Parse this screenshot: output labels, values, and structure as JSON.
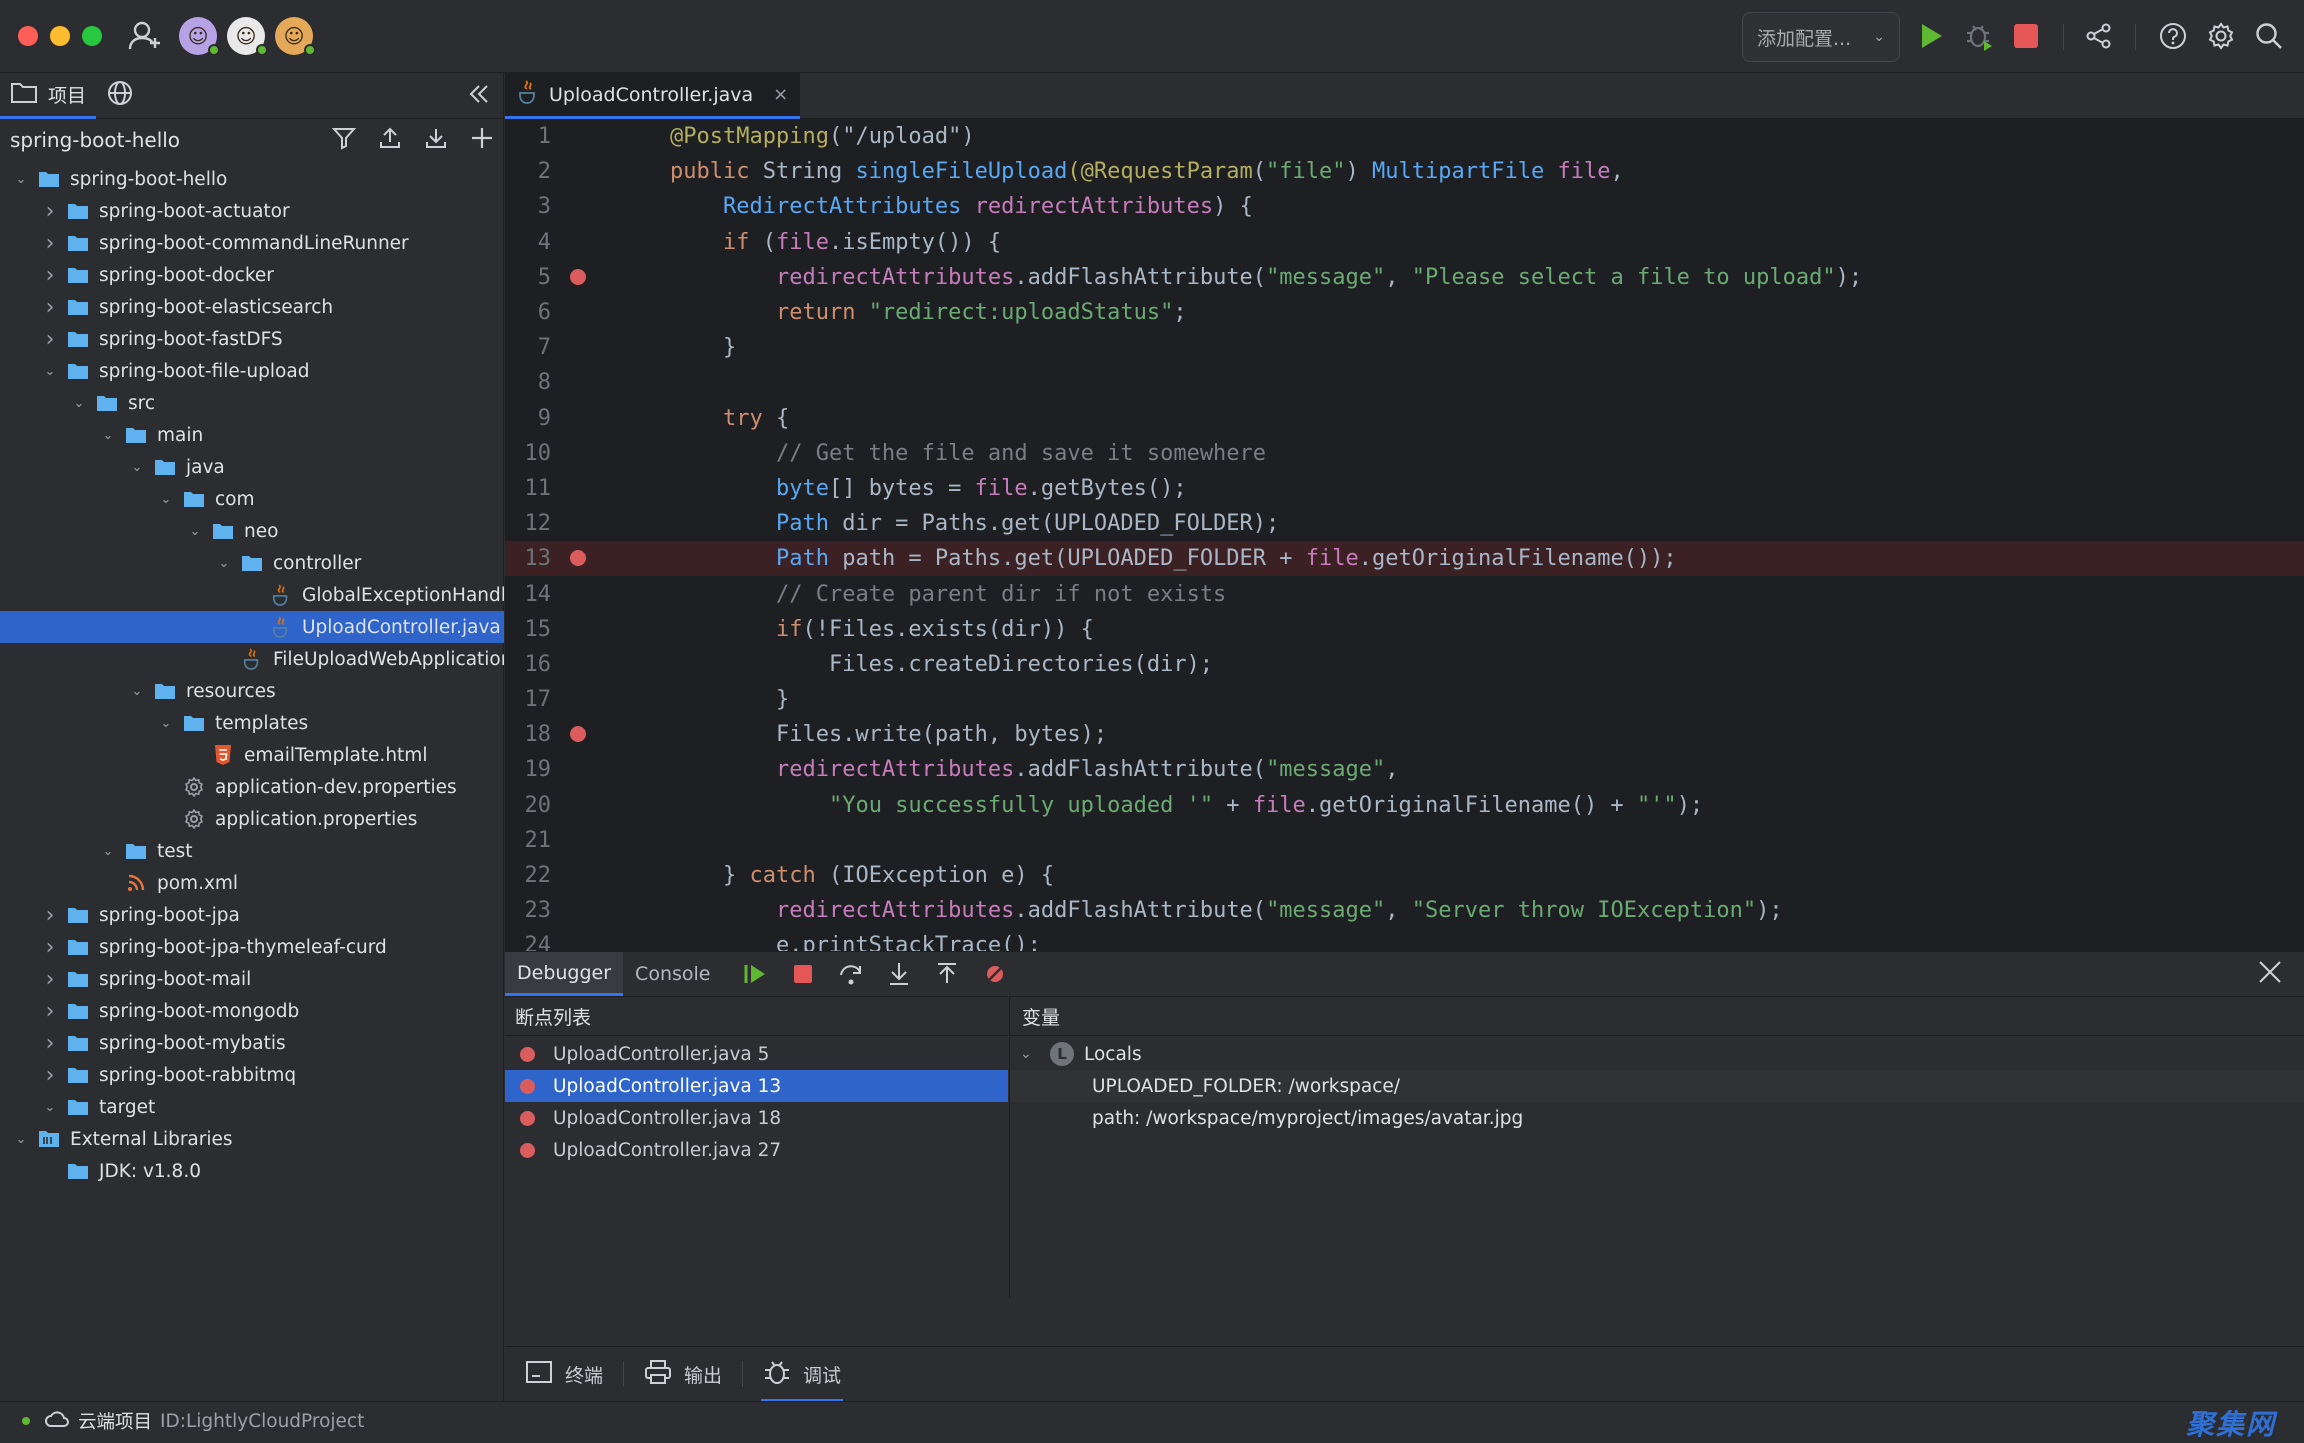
{
  "titlebar": {
    "config_label": "添加配置...",
    "avatars": [
      "user-avatar-1",
      "user-avatar-2",
      "user-avatar-3"
    ]
  },
  "left_panel": {
    "tab_project": "项目",
    "project_name": "spring-boot-hello",
    "tree": [
      {
        "label": "spring-boot-hello",
        "depth": 0,
        "expanded": true,
        "icon": "module-folder"
      },
      {
        "label": "spring-boot-actuator",
        "depth": 1,
        "expanded": false,
        "icon": "folder"
      },
      {
        "label": "spring-boot-commandLineRunner",
        "depth": 1,
        "expanded": false,
        "icon": "folder"
      },
      {
        "label": "spring-boot-docker",
        "depth": 1,
        "expanded": false,
        "icon": "folder"
      },
      {
        "label": "spring-boot-elasticsearch",
        "depth": 1,
        "expanded": false,
        "icon": "folder"
      },
      {
        "label": "spring-boot-fastDFS",
        "depth": 1,
        "expanded": false,
        "icon": "folder"
      },
      {
        "label": "spring-boot-file-upload",
        "depth": 1,
        "expanded": true,
        "icon": "folder"
      },
      {
        "label": "src",
        "depth": 2,
        "expanded": true,
        "icon": "folder"
      },
      {
        "label": "main",
        "depth": 3,
        "expanded": true,
        "icon": "folder"
      },
      {
        "label": "java",
        "depth": 4,
        "expanded": true,
        "icon": "folder"
      },
      {
        "label": "com",
        "depth": 5,
        "expanded": true,
        "icon": "folder"
      },
      {
        "label": "neo",
        "depth": 6,
        "expanded": true,
        "icon": "folder"
      },
      {
        "label": "controller",
        "depth": 7,
        "expanded": true,
        "icon": "folder"
      },
      {
        "label": "GlobalExceptionHandler.java",
        "depth": 8,
        "expanded": null,
        "icon": "java"
      },
      {
        "label": "UploadController.java",
        "depth": 8,
        "expanded": null,
        "icon": "java",
        "selected": true
      },
      {
        "label": "FileUploadWebApplication.java",
        "depth": 7,
        "expanded": null,
        "icon": "java"
      },
      {
        "label": "resources",
        "depth": 4,
        "expanded": true,
        "icon": "folder"
      },
      {
        "label": "templates",
        "depth": 5,
        "expanded": true,
        "icon": "folder"
      },
      {
        "label": "emailTemplate.html",
        "depth": 6,
        "expanded": null,
        "icon": "html"
      },
      {
        "label": "application-dev.properties",
        "depth": 5,
        "expanded": null,
        "icon": "gear"
      },
      {
        "label": "application.properties",
        "depth": 5,
        "expanded": null,
        "icon": "gear"
      },
      {
        "label": "test",
        "depth": 3,
        "expanded": true,
        "icon": "folder"
      },
      {
        "label": "pom.xml",
        "depth": 3,
        "expanded": null,
        "icon": "xml"
      },
      {
        "label": "spring-boot-jpa",
        "depth": 1,
        "expanded": false,
        "icon": "folder"
      },
      {
        "label": "spring-boot-jpa-thymeleaf-curd",
        "depth": 1,
        "expanded": false,
        "icon": "folder"
      },
      {
        "label": "spring-boot-mail",
        "depth": 1,
        "expanded": false,
        "icon": "folder"
      },
      {
        "label": "spring-boot-mongodb",
        "depth": 1,
        "expanded": false,
        "icon": "folder"
      },
      {
        "label": "spring-boot-mybatis",
        "depth": 1,
        "expanded": false,
        "icon": "folder"
      },
      {
        "label": "spring-boot-rabbitmq",
        "depth": 1,
        "expanded": false,
        "icon": "folder"
      },
      {
        "label": "target",
        "depth": 1,
        "expanded": true,
        "icon": "folder"
      },
      {
        "label": "External Libraries",
        "depth": 0,
        "expanded": true,
        "icon": "library"
      },
      {
        "label": "JDK: v1.8.0",
        "depth": 1,
        "expanded": null,
        "icon": "folder"
      }
    ]
  },
  "editor": {
    "tab_label": "UploadController.java",
    "highlight_line": 13,
    "breakpoint_lines": [
      5,
      13,
      18
    ],
    "lines": [
      [
        [
          "ann",
          "@PostMapping"
        ],
        [
          "id",
          "(\"/upload\")"
        ]
      ],
      [
        [
          "kw",
          "public "
        ],
        [
          "id",
          "String "
        ],
        [
          "cls",
          "singleFileUpload"
        ],
        [
          "ann",
          "("
        ],
        [
          "ann",
          "@RequestParam"
        ],
        [
          "id",
          "("
        ],
        [
          "str",
          "\"file\""
        ],
        [
          "id",
          ") "
        ],
        [
          "cls",
          "MultipartFile "
        ],
        [
          "ty",
          "file"
        ],
        [
          "id",
          ","
        ]
      ],
      [
        [
          "id",
          "    "
        ],
        [
          "cls",
          "RedirectAttributes "
        ],
        [
          "ty",
          "redirectAttributes"
        ],
        [
          "id",
          ") {"
        ]
      ],
      [
        [
          "id",
          "    "
        ],
        [
          "kw",
          "if "
        ],
        [
          "id",
          "("
        ],
        [
          "ty",
          "file"
        ],
        [
          "id",
          ".isEmpty()) {"
        ]
      ],
      [
        [
          "id",
          "        "
        ],
        [
          "ty",
          "redirectAttributes"
        ],
        [
          "id",
          ".addFlashAttribute("
        ],
        [
          "str",
          "\"message\""
        ],
        [
          "id",
          ", "
        ],
        [
          "str",
          "\"Please select a file to upload\""
        ],
        [
          "id",
          ");"
        ]
      ],
      [
        [
          "id",
          "        "
        ],
        [
          "kw",
          "return "
        ],
        [
          "str",
          "\"redirect:uploadStatus\""
        ],
        [
          "id",
          ";"
        ]
      ],
      [
        [
          "id",
          "    }"
        ]
      ],
      [
        [
          "id",
          ""
        ]
      ],
      [
        [
          "id",
          "    "
        ],
        [
          "kw",
          "try "
        ],
        [
          "id",
          "{"
        ]
      ],
      [
        [
          "id",
          "        "
        ],
        [
          "cm",
          "// Get the file and save it somewhere"
        ]
      ],
      [
        [
          "id",
          "        "
        ],
        [
          "cls",
          "byte"
        ],
        [
          "id",
          "[] bytes = "
        ],
        [
          "ty",
          "file"
        ],
        [
          "id",
          ".getBytes();"
        ]
      ],
      [
        [
          "id",
          "        "
        ],
        [
          "cls",
          "Path "
        ],
        [
          "id",
          "dir = Paths.get(UPLOADED_FOLDER);"
        ]
      ],
      [
        [
          "id",
          "        "
        ],
        [
          "cls",
          "Path "
        ],
        [
          "id",
          "path = Paths.get(UPLOADED_FOLDER + "
        ],
        [
          "ty",
          "file"
        ],
        [
          "id",
          ".getOriginalFilename());"
        ]
      ],
      [
        [
          "id",
          "        "
        ],
        [
          "cm",
          "// Create parent dir if not exists"
        ]
      ],
      [
        [
          "id",
          "        "
        ],
        [
          "kw",
          "if"
        ],
        [
          "id",
          "(!Files.exists(dir)) {"
        ]
      ],
      [
        [
          "id",
          "            Files.createDirectories(dir);"
        ]
      ],
      [
        [
          "id",
          "        }"
        ]
      ],
      [
        [
          "id",
          "        Files.write(path, bytes);"
        ]
      ],
      [
        [
          "id",
          "        "
        ],
        [
          "ty",
          "redirectAttributes"
        ],
        [
          "id",
          ".addFlashAttribute("
        ],
        [
          "str",
          "\"message\""
        ],
        [
          "id",
          ","
        ]
      ],
      [
        [
          "id",
          "            "
        ],
        [
          "str",
          "\"You successfully uploaded '\""
        ],
        [
          "id",
          " + "
        ],
        [
          "ty",
          "file"
        ],
        [
          "id",
          ".getOriginalFilename() + "
        ],
        [
          "str",
          "\"'\""
        ],
        [
          "id",
          ");"
        ]
      ],
      [
        [
          "id",
          ""
        ]
      ],
      [
        [
          "id",
          "    } "
        ],
        [
          "kw",
          "catch "
        ],
        [
          "id",
          "(IOException e) {"
        ]
      ],
      [
        [
          "id",
          "        "
        ],
        [
          "ty",
          "redirectAttributes"
        ],
        [
          "id",
          ".addFlashAttribute("
        ],
        [
          "str",
          "\"message\""
        ],
        [
          "id",
          ", "
        ],
        [
          "str",
          "\"Server throw IOException\""
        ],
        [
          "id",
          ");"
        ]
      ],
      [
        [
          "id",
          "        e.printStackTrace();"
        ]
      ]
    ]
  },
  "debugger": {
    "tab_debugger": "Debugger",
    "tab_console": "Console",
    "breakpoints_header": "断点列表",
    "variables_header": "变量",
    "breakpoints": [
      {
        "label": "UploadController.java 5",
        "selected": false
      },
      {
        "label": "UploadController.java 13",
        "selected": true
      },
      {
        "label": "UploadController.java 18",
        "selected": false
      },
      {
        "label": "UploadController.java 27",
        "selected": false
      }
    ],
    "locals_label": "Locals",
    "variables": [
      "UPLOADED_FOLDER: /workspace/",
      "path: /workspace/myproject/images/avatar.jpg"
    ]
  },
  "bottom_tabs": {
    "terminal": "终端",
    "output": "输出",
    "debug": "调试"
  },
  "status": {
    "project_label": "云端项目",
    "project_id": "ID:LightlyCloudProject"
  },
  "watermark": "聚集网",
  "colors": {
    "accent": "#3574f0",
    "selection": "#2f65ca",
    "breakpoint": "#db5c5c",
    "run_green": "#5fb832",
    "folder_blue": "#5fb2ee"
  }
}
